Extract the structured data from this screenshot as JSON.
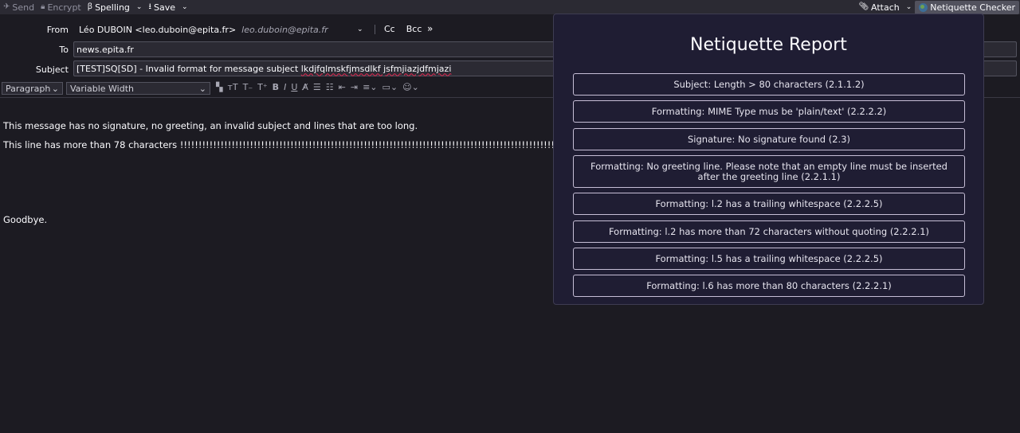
{
  "toolbar": {
    "send": "Send",
    "encrypt": "Encrypt",
    "spelling": "Spelling",
    "save": "Save",
    "attach": "Attach",
    "netiquette": "Netiquette Checker"
  },
  "header": {
    "from_label": "From",
    "from_value": "Léo DUBOIN <leo.duboin@epita.fr>",
    "from_email": "leo.duboin@epita.fr",
    "cc": "Cc",
    "bcc": "Bcc",
    "to_label": "To",
    "to_value": "news.epita.fr",
    "subject_label": "Subject",
    "subject_prefix": "[TEST]SQ[SD] - Invalid format for message subject ",
    "subject_misspelled": "lkdjfqlmskfjmsdlkf jsfmjiazjdfmjazi"
  },
  "format": {
    "paragraph": "Paragraph",
    "font": "Variable Width"
  },
  "body": {
    "line1": "This message has no signature, no greeting, an invalid subject and lines that are too long.",
    "line2": "This line has more than 78 characters !!!!!!!!!!!!!!!!!!!!!!!!!!!!!!!!!!!!!!!!!!!!!!!!!!!!!!!!!!!!!!!!!!!!!!!!!!!!!!!!!!!!!!!!!!!!!!!!!!!!!!!!!!!",
    "line3": "Goodbye."
  },
  "report": {
    "title": "Netiquette Report",
    "items": [
      "Subject: Length > 80 characters (2.1.1.2)",
      "Formatting: MIME Type mus be 'plain/text' (2.2.2.2)",
      "Signature: No signature found (2.3)",
      "Formatting: No greeting line. Please note that an empty line must be inserted after the greeting line (2.2.1.1)",
      "Formatting: l.2 has a trailing whitespace (2.2.2.5)",
      "Formatting: l.2 has more than 72 characters without quoting (2.2.2.1)",
      "Formatting: l.5 has a trailing whitespace (2.2.2.5)",
      "Formatting: l.6 has more than 80 characters (2.2.2.1)"
    ]
  }
}
